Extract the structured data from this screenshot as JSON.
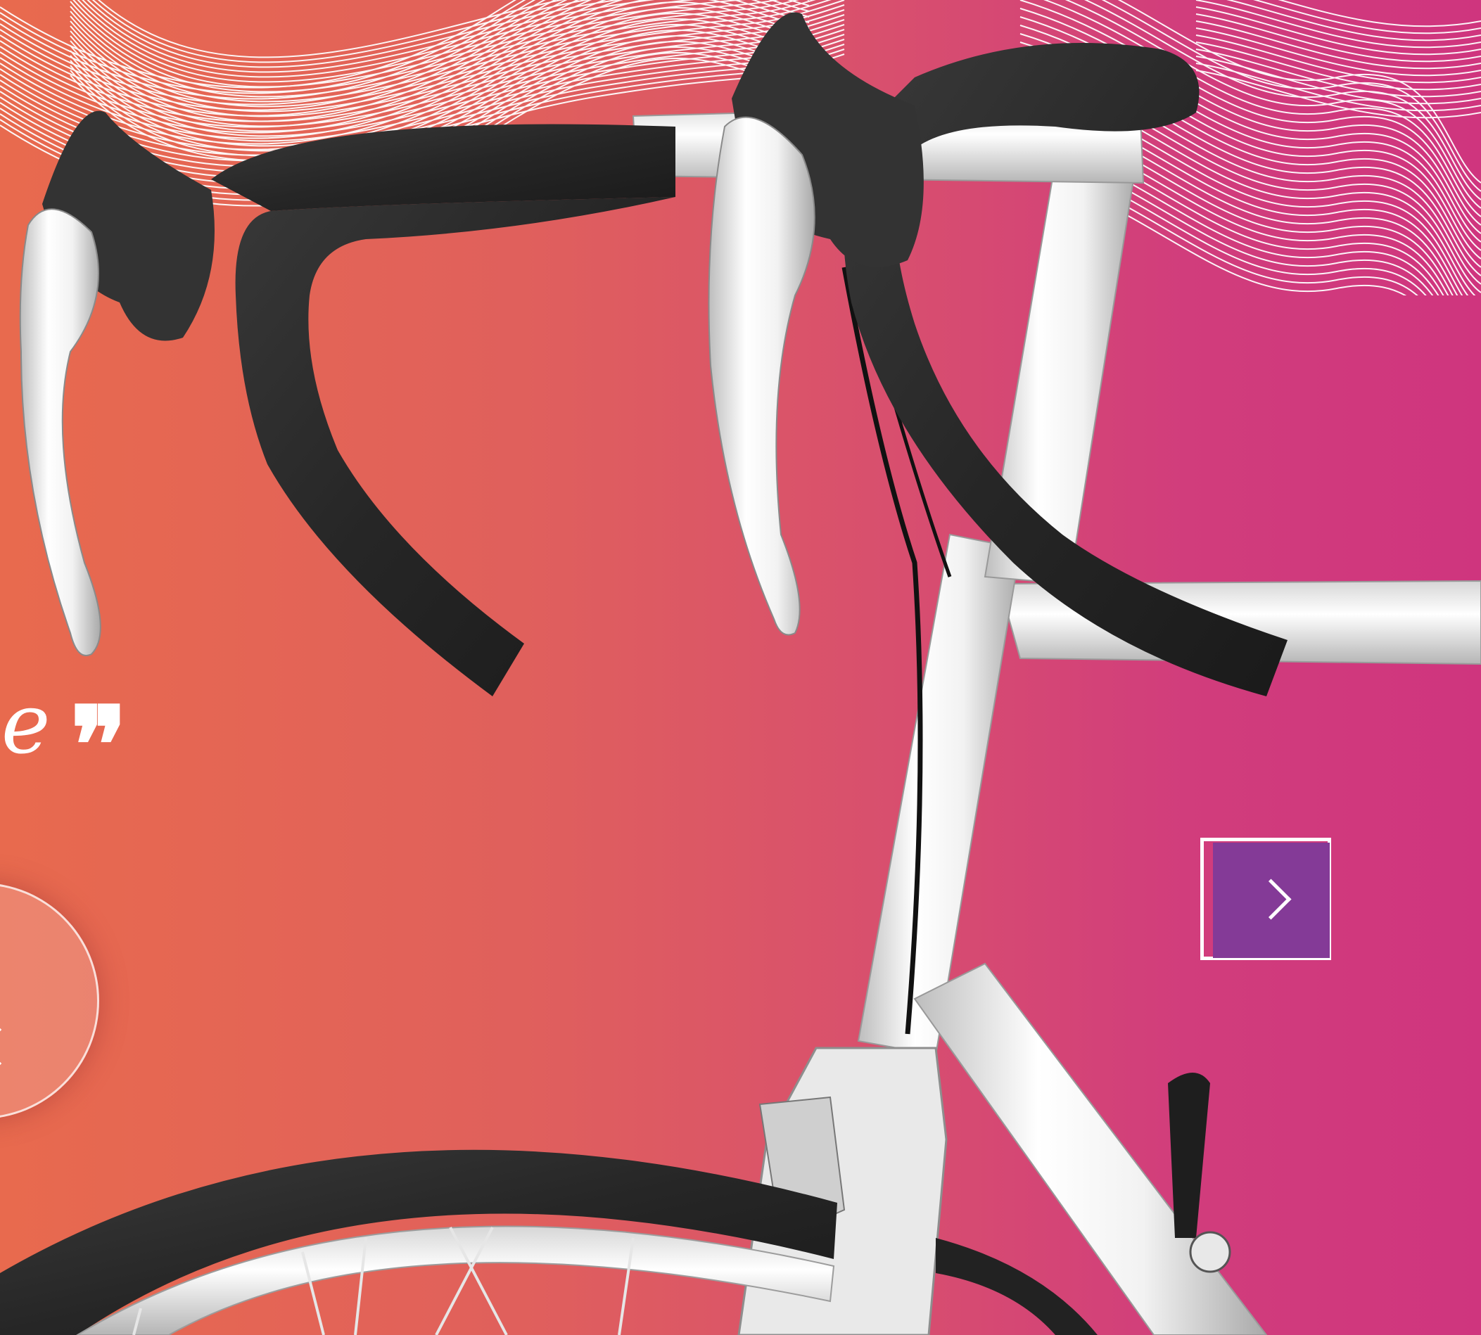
{
  "hero": {
    "quote_text": "le",
    "quote_mark": "❞",
    "colors": {
      "gradient_left": "#e86a4e",
      "gradient_mid": "#d84f6e",
      "gradient_right": "#cf357e",
      "next_button": "#843a97",
      "line_art": "#ffffff"
    },
    "icons": {
      "prev": "chevron-left-icon",
      "next": "chevron-right-icon"
    }
  }
}
